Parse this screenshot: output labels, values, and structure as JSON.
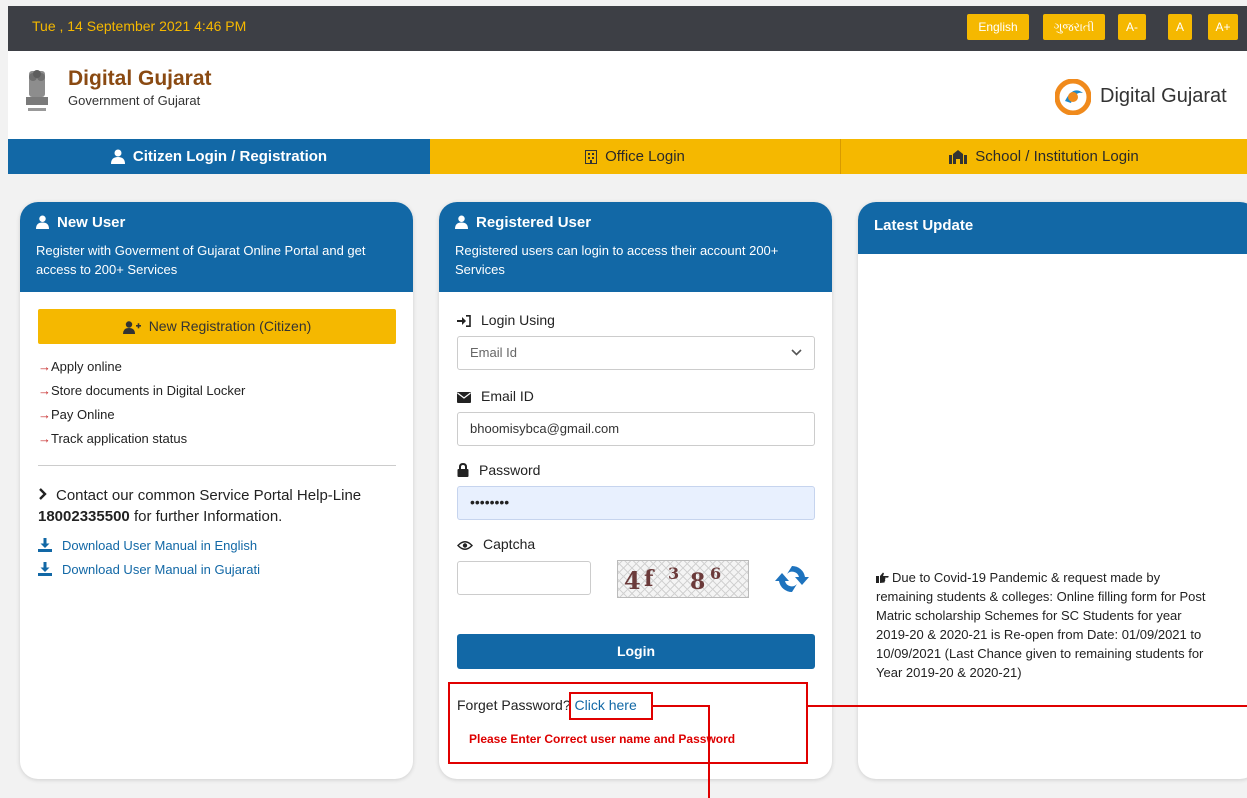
{
  "topbar": {
    "datetime": "Tue , 14 September 2021 4:46 PM",
    "languages": [
      "English",
      "ગુજરાતી",
      "A-",
      "A",
      "A+"
    ]
  },
  "header": {
    "title": "Digital Gujarat",
    "subtitle": "Government of Gujarat",
    "logo_text": "Digital Gujarat"
  },
  "nav": {
    "tabs": [
      {
        "label": "Citizen Login / Registration",
        "active": true
      },
      {
        "label": "Office Login",
        "active": false
      },
      {
        "label": "School / Institution Login",
        "active": false
      }
    ]
  },
  "new_user": {
    "title": "New User",
    "description": "Register with Goverment of Gujarat Online Portal and get access to 200+ Services",
    "register_button": "New Registration (Citizen)",
    "features": [
      "Apply online",
      "Store documents in Digital Locker",
      "Pay Online",
      "Track application status"
    ],
    "arrow": "→",
    "contact_prefix": "Contact our common Service Portal Help-Line",
    "helpline": "18002335500",
    "contact_suffix": "for further Information.",
    "downloads": [
      "Download User Manual in English",
      "Download User Manual in Gujarati"
    ]
  },
  "registered_user": {
    "title": "Registered User",
    "description": "Registered users can login to access their account 200+ Services",
    "login_using_label": "Login Using",
    "login_using_value": "Email Id",
    "email_label": "Email ID",
    "email_value": "bhoomisybca@gmail.com",
    "password_label": "Password",
    "password_value": "••••••••",
    "captcha_label": "Captcha",
    "captcha_chars": [
      "4",
      "f",
      "3",
      "8",
      "6"
    ],
    "login_button": "Login",
    "forgot_text": "Forget Password?",
    "forgot_link": "Click here",
    "error_message": "Please Enter Correct user name and Password"
  },
  "latest_update": {
    "title": "Latest Update",
    "message": "Due to Covid-19 Pandemic & request made by remaining students & colleges: Online filling form for Post Matric scholarship Schemes for SC Students for year 2019-20 & 2020-21 is Re-open from Date: 01/09/2021 to 10/09/2021 (Last Chance given to remaining students for Year 2019-20 & 2020-21)"
  },
  "colors": {
    "primary": "#1268a6",
    "accent": "#f5b800",
    "topbar": "#3d3f45",
    "error": "#dd0000"
  }
}
